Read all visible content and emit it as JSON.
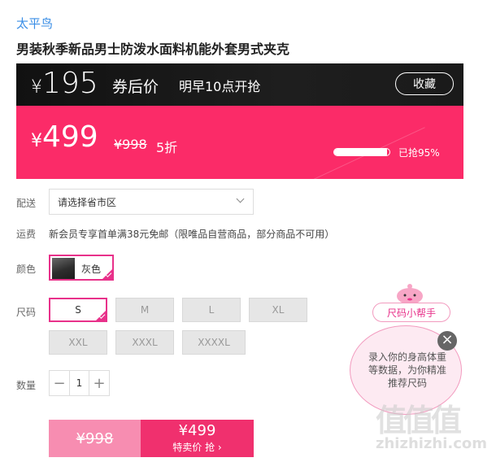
{
  "brand": "太平鸟",
  "title": "男装秋季新品男士防泼水面料机能外套男式夹克",
  "coupon_price": {
    "currency": "¥",
    "amount": "195",
    "label": "券后价",
    "time": "明早10点开抢"
  },
  "favorite_label": "收藏",
  "sale": {
    "currency": "¥",
    "amount": "499",
    "original": "¥998",
    "discount": "5折",
    "progress_percent": 95,
    "sold_label": "已抢95%"
  },
  "delivery": {
    "label": "配送",
    "placeholder": "请选择省市区"
  },
  "shipping": {
    "label": "运费",
    "text": "新会员专享首单满38元免邮（限唯品自营商品，部分商品不可用）"
  },
  "color": {
    "label": "颜色",
    "options": [
      "灰色"
    ],
    "selected": "灰色"
  },
  "size": {
    "label": "尺码",
    "options": [
      "S",
      "M",
      "L",
      "XL",
      "XXL",
      "XXXL",
      "XXXXL"
    ],
    "selected": "S"
  },
  "quantity": {
    "label": "数量",
    "value": "1",
    "minus": "−",
    "plus": "+"
  },
  "buy": {
    "original": "¥998",
    "price": "¥499",
    "action": "特卖价 抢 ›"
  },
  "size_helper": {
    "button": "尺码小帮手",
    "tip": "录入你的身高体重等数据，为你精准推荐尺码",
    "close": "×"
  },
  "watermark": {
    "logo": "值值值",
    "text": "zhizhizhi.com"
  },
  "colors": {
    "pink": "#fb2b68",
    "accent": "#e8318a",
    "dark": "#111111",
    "brand_blue": "#3a8ee6"
  }
}
